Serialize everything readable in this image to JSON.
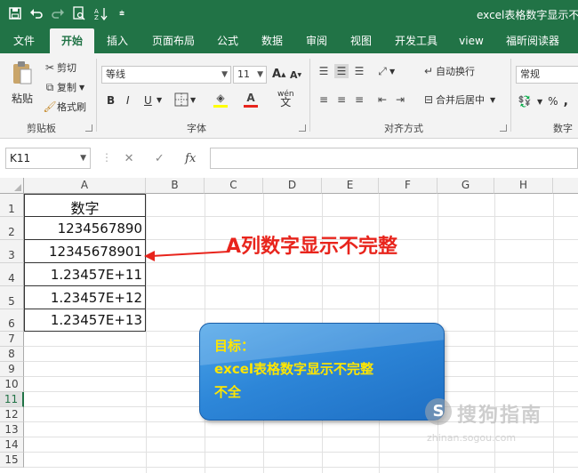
{
  "window": {
    "title": "excel表格数字显示不完",
    "qat": [
      "save-icon",
      "undo-icon",
      "redo-icon",
      "print-preview-icon",
      "sort-icon",
      "customize-icon"
    ]
  },
  "tabs": [
    "文件",
    "开始",
    "插入",
    "页面布局",
    "公式",
    "数据",
    "审阅",
    "视图",
    "开发工具",
    "view",
    "福昕阅读器"
  ],
  "active_tab": "开始",
  "ribbon": {
    "clipboard": {
      "paste": "粘贴",
      "cut": "剪切",
      "copy": "复制",
      "format_painter": "格式刷",
      "label": "剪贴板"
    },
    "font": {
      "font_name": "等线",
      "font_size": "11",
      "grow": "A",
      "shrink": "A",
      "bold": "B",
      "italic": "I",
      "underline": "U",
      "phonetic": "wén",
      "label": "字体"
    },
    "alignment": {
      "wrap_text": "自动换行",
      "merge_center": "合并后居中",
      "label": "对齐方式"
    },
    "number": {
      "format": "常规",
      "percent": "%",
      "comma": ",",
      "label": "数字"
    }
  },
  "formula_bar": {
    "name_box": "K11",
    "cancel": "✕",
    "enter": "✓",
    "fx": "fx",
    "value": ""
  },
  "columns": [
    "A",
    "B",
    "C",
    "D",
    "E",
    "F",
    "G",
    "H"
  ],
  "rows": [
    "1",
    "2",
    "3",
    "4",
    "5",
    "6",
    "7",
    "8",
    "9",
    "10",
    "11",
    "12",
    "13",
    "14",
    "15"
  ],
  "selected_row": "11",
  "cells": {
    "A1": "数字",
    "A2": "1234567890",
    "A3": "12345678901",
    "A4": "1.23457E+11",
    "A5": "1.23457E+12",
    "A6": "1.23457E+13"
  },
  "annotation": {
    "text": "A列数字显示不完整",
    "color": "#e8241c"
  },
  "goal_box": {
    "line1": "目标：",
    "line2": "excel表格数字显示不完整",
    "line3": "不全"
  },
  "watermark": {
    "logo": "S",
    "name": "搜狗指南",
    "url": "zhinan.sogou.com"
  },
  "colors": {
    "excel_green": "#217346",
    "goal_text": "#ffe600",
    "goal_bg": "#2d86d8"
  }
}
